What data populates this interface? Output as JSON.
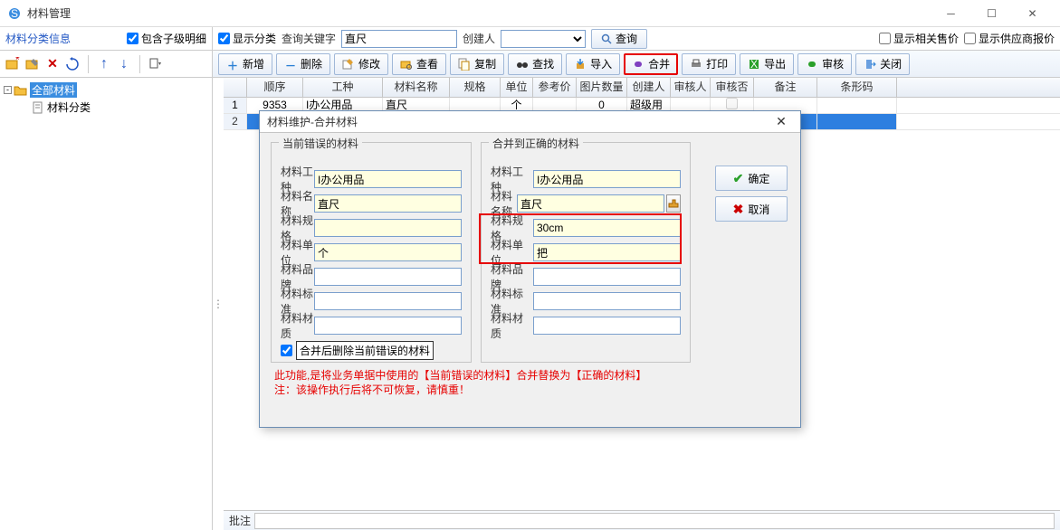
{
  "window": {
    "title": "材料管理"
  },
  "left_panel": {
    "title": "材料分类信息",
    "checkbox_label": "包含子级明细",
    "tree": {
      "root": "全部材料",
      "child": "材料分类"
    }
  },
  "search": {
    "show_category": "显示分类",
    "keyword_label": "查询关键字",
    "keyword_value": "直尺",
    "creator_label": "创建人",
    "creator_value": "",
    "btn": "查询",
    "show_related_price": "显示相关售价",
    "show_supplier_quote": "显示供应商报价"
  },
  "toolbar": {
    "add": "新增",
    "del": "删除",
    "edit": "修改",
    "view": "查看",
    "copy": "复制",
    "find": "查找",
    "import": "导入",
    "merge": "合并",
    "print": "打印",
    "export": "导出",
    "audit": "审核",
    "close": "关闭"
  },
  "grid": {
    "cols": [
      "",
      "顺序",
      "工种",
      "材料名称",
      "规格",
      "单位",
      "参考价",
      "图片数量",
      "创建人",
      "审核人",
      "审核否",
      "备注",
      "条形码"
    ],
    "rows": [
      {
        "seq": "1",
        "order": "9353",
        "trade": "I办公用品",
        "name": "直尺",
        "spec": "",
        "unit": "个",
        "price": "",
        "imgs": "0",
        "creator": "超级用户",
        "auditor": "",
        "audit": "",
        "remark": "",
        "barcode": ""
      },
      {
        "seq": "2",
        "order": "",
        "trade": "",
        "name": "",
        "spec": "",
        "unit": "",
        "price": "",
        "imgs": "",
        "creator": "",
        "auditor": "",
        "audit": "",
        "remark": "",
        "barcode": ""
      }
    ]
  },
  "bottom": {
    "label": "批注"
  },
  "dialog": {
    "title": "材料维护-合并材料",
    "group_wrong": "当前错误的材料",
    "group_right": "合并到正确的材料",
    "labels": {
      "trade": "材料工种",
      "name": "材料名称",
      "spec": "材料规格",
      "unit": "材料单位",
      "brand": "材料品牌",
      "std": "材料标准",
      "mat": "材料材质"
    },
    "wrong": {
      "trade": "I办公用品",
      "name": "直尺",
      "spec": "",
      "unit": "个",
      "brand": "",
      "std": "",
      "mat": ""
    },
    "right": {
      "trade": "I办公用品",
      "name": "直尺",
      "spec": "30cm",
      "unit": "把",
      "brand": "",
      "std": "",
      "mat": ""
    },
    "delete_after": "合并后删除当前错误的材料",
    "ok": "确定",
    "cancel": "取消",
    "note1": "此功能,是将业务单据中使用的【当前错误的材料】合并替换为【正确的材料】",
    "note2": "注：该操作执行后将不可恢复，请慎重！"
  }
}
